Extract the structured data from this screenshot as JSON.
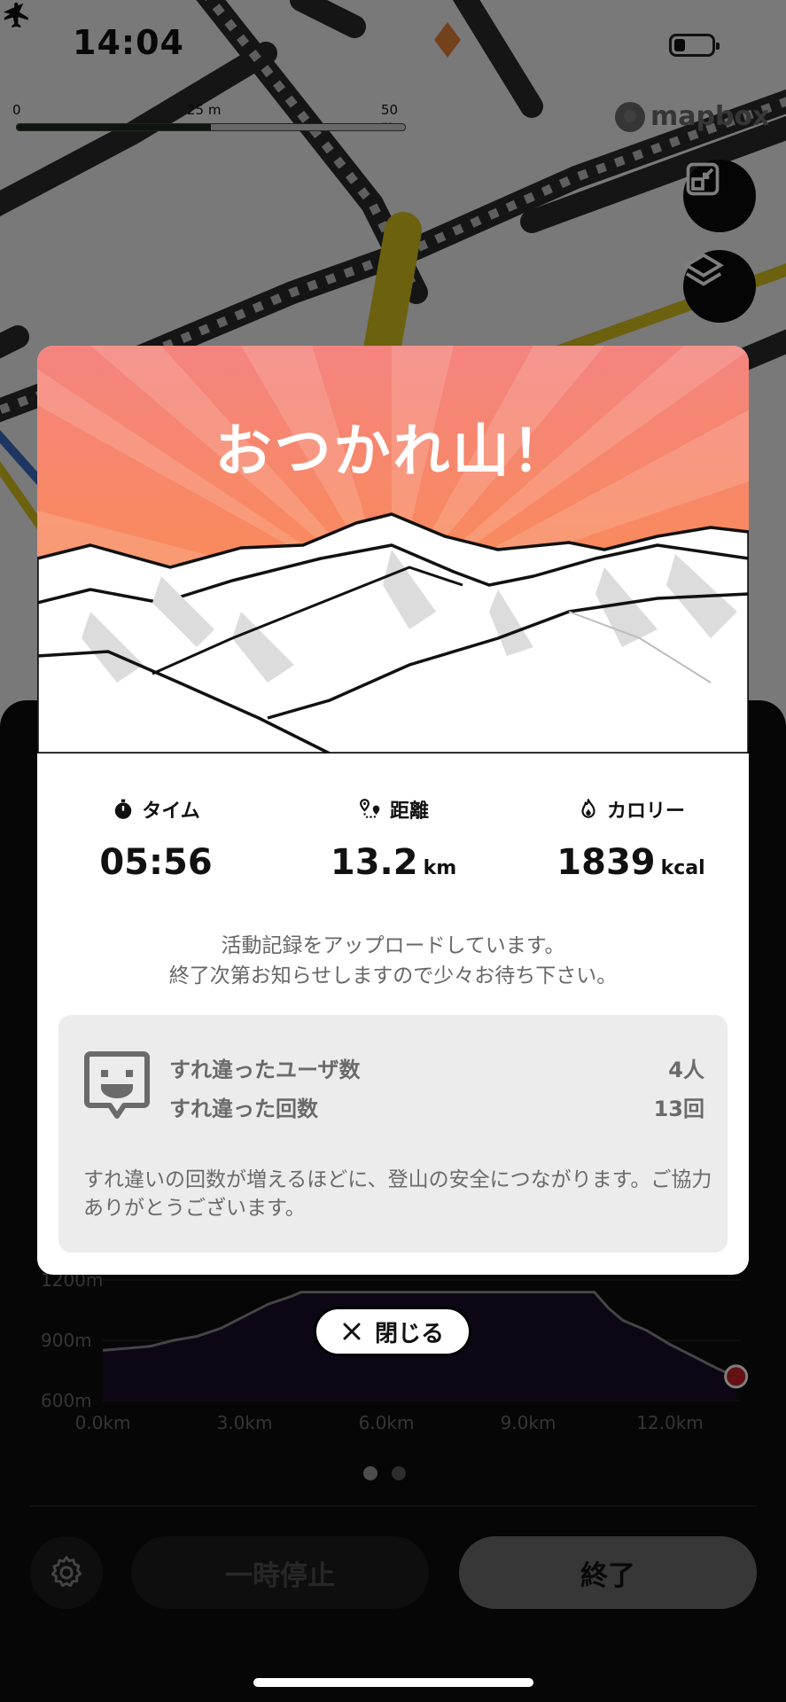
{
  "status_bar": {
    "time": "14:04",
    "icons": [
      "location-arrow-icon",
      "airplane-icon",
      "battery-icon"
    ],
    "battery_level": 0.2
  },
  "map": {
    "scale_labels": [
      "0",
      "25 m",
      "50 m"
    ],
    "attribution": "mapbox",
    "buttons": [
      "fullscreen-exit-icon",
      "layers-icon"
    ]
  },
  "modal": {
    "title": "おつかれ山！",
    "stats": [
      {
        "icon": "stopwatch-icon",
        "label": "タイム",
        "value": "05:56",
        "unit": ""
      },
      {
        "icon": "route-pin-icon",
        "label": "距離",
        "value": "13.2",
        "unit": "km"
      },
      {
        "icon": "flame-icon",
        "label": "カロリー",
        "value": "1839",
        "unit": "kcal"
      }
    ],
    "upload_message_line1": "活動記録をアップロードしています。",
    "upload_message_line2": "終了次第お知らせしますので少々お待ち下さい。",
    "encounter": {
      "icon": "smiley-badge-icon",
      "users_label": "すれ違ったユーザ数",
      "users_value": "4人",
      "count_label": "すれ違った回数",
      "count_value": "13回",
      "note": "すれ違いの回数が増えるほどに、登山の安全につながります。ご協力ありがとうございます。"
    }
  },
  "close_button": {
    "icon": "close-icon",
    "label": "閉じる"
  },
  "elevation_chart": {
    "y_ticks": [
      "1200m",
      "900m",
      "600m"
    ],
    "x_ticks": [
      "0.0km",
      "3.0km",
      "6.0km",
      "9.0km",
      "12.0km"
    ]
  },
  "chart_data": {
    "type": "area",
    "xlabel": "",
    "ylabel": "",
    "x_unit": "km",
    "y_unit": "m",
    "xlim": [
      0,
      13.5
    ],
    "ylim": [
      600,
      1250
    ],
    "x": [
      0,
      0.5,
      1,
      1.5,
      2,
      2.5,
      3,
      3.5,
      4,
      4.2,
      10.4,
      10.7,
      11,
      11.5,
      12,
      12.5,
      13,
      13.4
    ],
    "y": [
      850,
      860,
      870,
      900,
      920,
      960,
      1020,
      1080,
      1120,
      1140,
      1140,
      1060,
      1000,
      950,
      880,
      820,
      760,
      720
    ],
    "current_position_km": 13.4,
    "grid": true
  },
  "pager": {
    "pages": 2,
    "active": 0
  },
  "controls": {
    "settings_icon": "gear-icon",
    "pause_label": "一時停止",
    "end_label": "終了"
  }
}
